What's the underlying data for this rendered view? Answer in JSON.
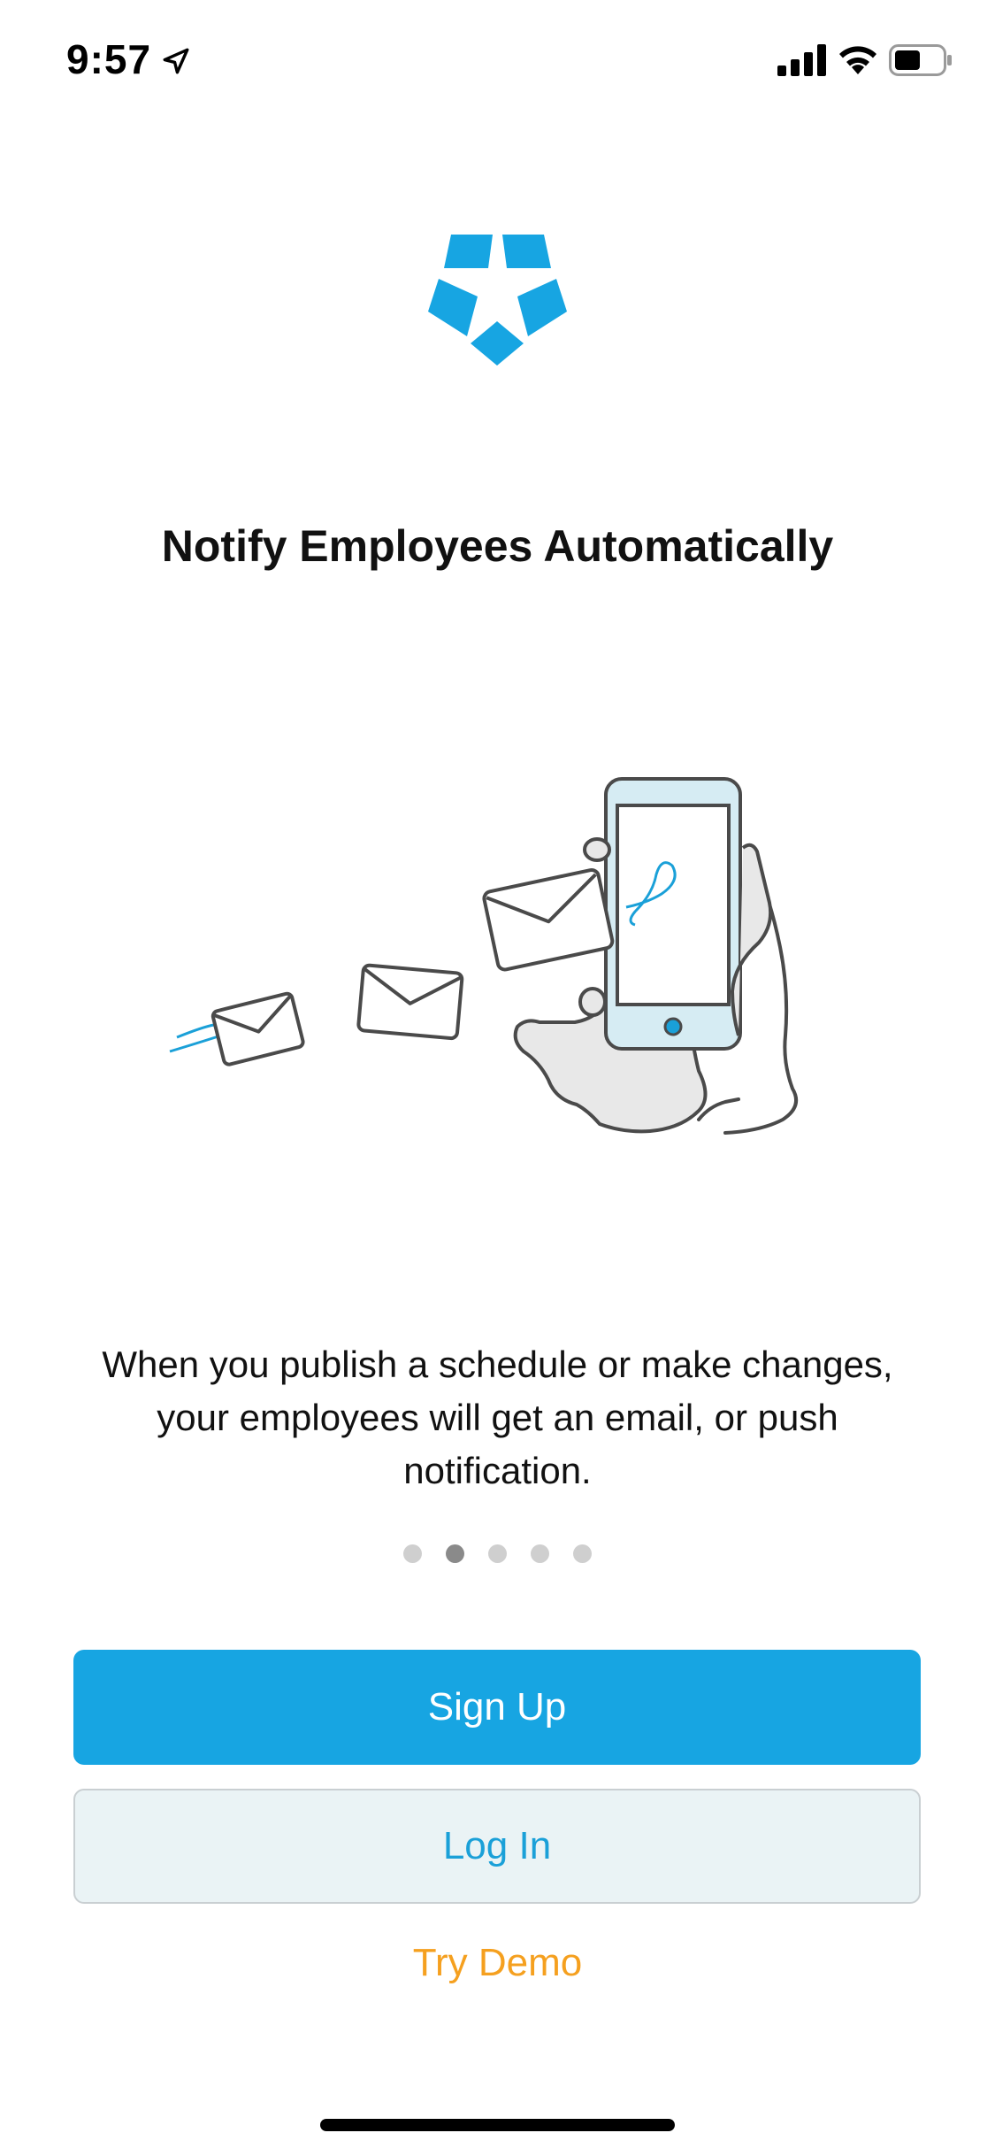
{
  "status_bar": {
    "time": "9:57",
    "icons": [
      "location-arrow-icon",
      "cellular-signal-icon",
      "wifi-icon",
      "battery-icon"
    ]
  },
  "logo": {
    "icon": "app-logo-icon",
    "color": "#17a5e2"
  },
  "onboarding": {
    "title": "Notify Employees Automatically",
    "illustration_icon": "hand-phone-envelopes-icon",
    "description": "When you publish a schedule or make changes, your employees will get an email, or push notification.",
    "pager": {
      "total_pages": 5,
      "current_page": 2
    }
  },
  "actions": {
    "signup_label": "Sign Up",
    "login_label": "Log In",
    "demo_label": "Try Demo"
  },
  "colors": {
    "primary": "#17a5e2",
    "secondary_bg": "#eaf3f5",
    "accent": "#f5a01f"
  }
}
